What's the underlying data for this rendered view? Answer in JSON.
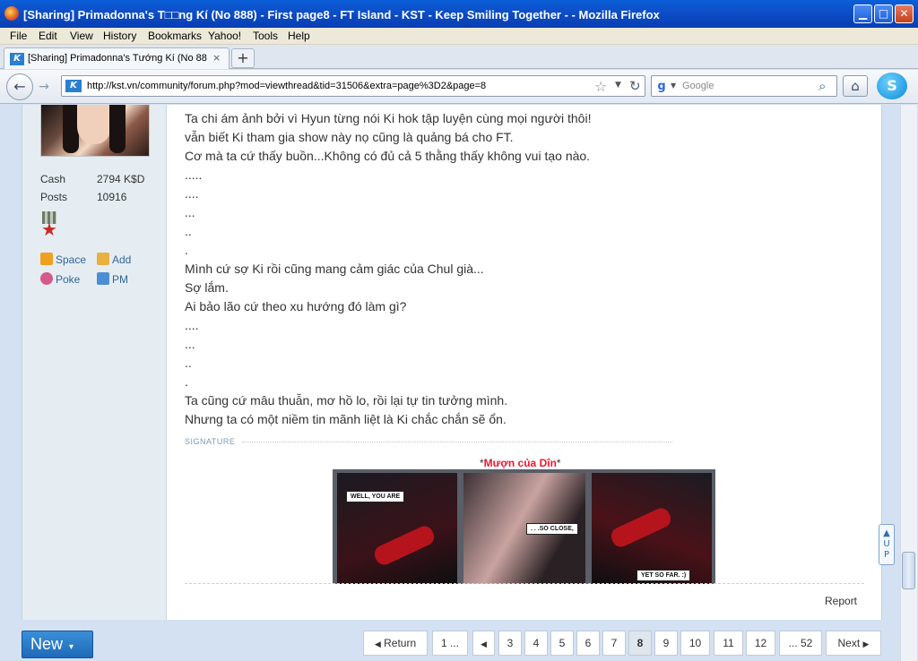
{
  "window": {
    "title": "[Sharing] Primadonna's T□□ng Kí (No 888) - First page8 - FT Island - KST - Keep Smiling Together - - Mozilla Firefox"
  },
  "menu": [
    "File",
    "Edit",
    "View",
    "History",
    "Bookmarks",
    "Yahoo!",
    "Tools",
    "Help"
  ],
  "tab": {
    "label": "[Sharing] Primadonna's Tướng Kí (No 888) - ...",
    "close": "×"
  },
  "nav": {
    "url": "http://kst.vn/community/forum.php?mod=viewthread&tid=31506&extra=page%3D2&page=8",
    "search_placeholder": "Google"
  },
  "profile": {
    "stats": [
      {
        "label": "Cash",
        "value": "2794 K$D"
      },
      {
        "label": "Posts",
        "value": "10916"
      }
    ],
    "actions": {
      "space": "Space",
      "add": "Add",
      "poke": "Poke",
      "pm": "PM"
    }
  },
  "post": {
    "lines": [
      "Ta chi ám ảnh bởi vì Hyun từng nói Ki hok tập luyện cùng mọi người thôi!",
      "vẫn biết Ki tham gia show này nọ cũng là quảng bá cho FT.",
      "Cơ mà ta cứ thấy buồn...Không có đủ cả 5 thằng thấy không vui tạo nào.",
      ".....",
      "....",
      "...",
      "..",
      ".",
      "Mình cứ sợ Ki rồi cũng mang cảm giác của Chul già...",
      "Sợ lắm.",
      "Ai bảo lão cứ theo xu hướng đó làm gì?",
      "....",
      "...",
      "..",
      ".",
      "Ta cũng cứ mâu thuẫn, mơ hồ lo, rồi lại tự tin tưởng mình.",
      "Nhưng ta có một niềm tin mãnh liệt là Ki chắc chắn sẽ ổn."
    ],
    "signature_label": "SIGNATURE",
    "signature_caption": "Mượn của Dîn",
    "comic": [
      "WELL, YOU ARE",
      ". . .SO CLOSE,",
      "YET SO FAR. :)"
    ],
    "report": "Report"
  },
  "pagination": {
    "new_label": "New",
    "return_label": "Return",
    "first": "1 ...",
    "pages": [
      "3",
      "4",
      "5",
      "6",
      "7",
      "8",
      "9",
      "10",
      "11",
      "12"
    ],
    "current": "8",
    "last": "... 52",
    "next_label": "Next"
  },
  "colors": {
    "accent": "#1f6ab8",
    "signature_caption": "#e8182f",
    "sidebar_bg": "#e5edf2"
  }
}
